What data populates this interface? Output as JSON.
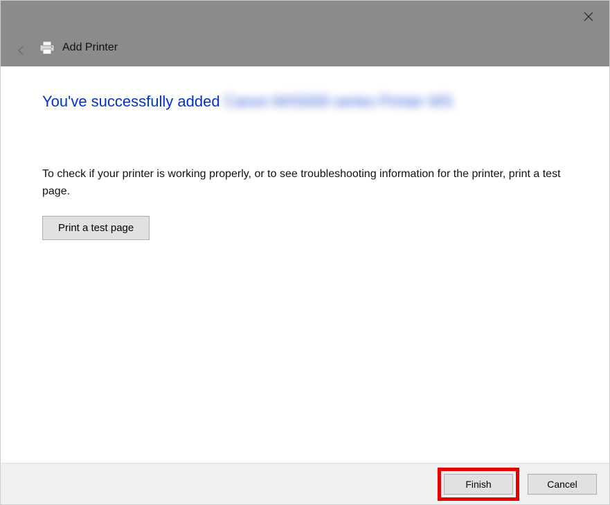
{
  "titlebar": {
    "window_title": "Add Printer"
  },
  "main": {
    "heading_prefix": "You've successfully added ",
    "heading_printer_name": "Canon MX5000 series Printer WS",
    "body_text": "To check if your printer is working properly, or to see troubleshooting information for the printer, print a test page.",
    "test_button_label": "Print a test page"
  },
  "footer": {
    "finish_label": "Finish",
    "cancel_label": "Cancel"
  }
}
